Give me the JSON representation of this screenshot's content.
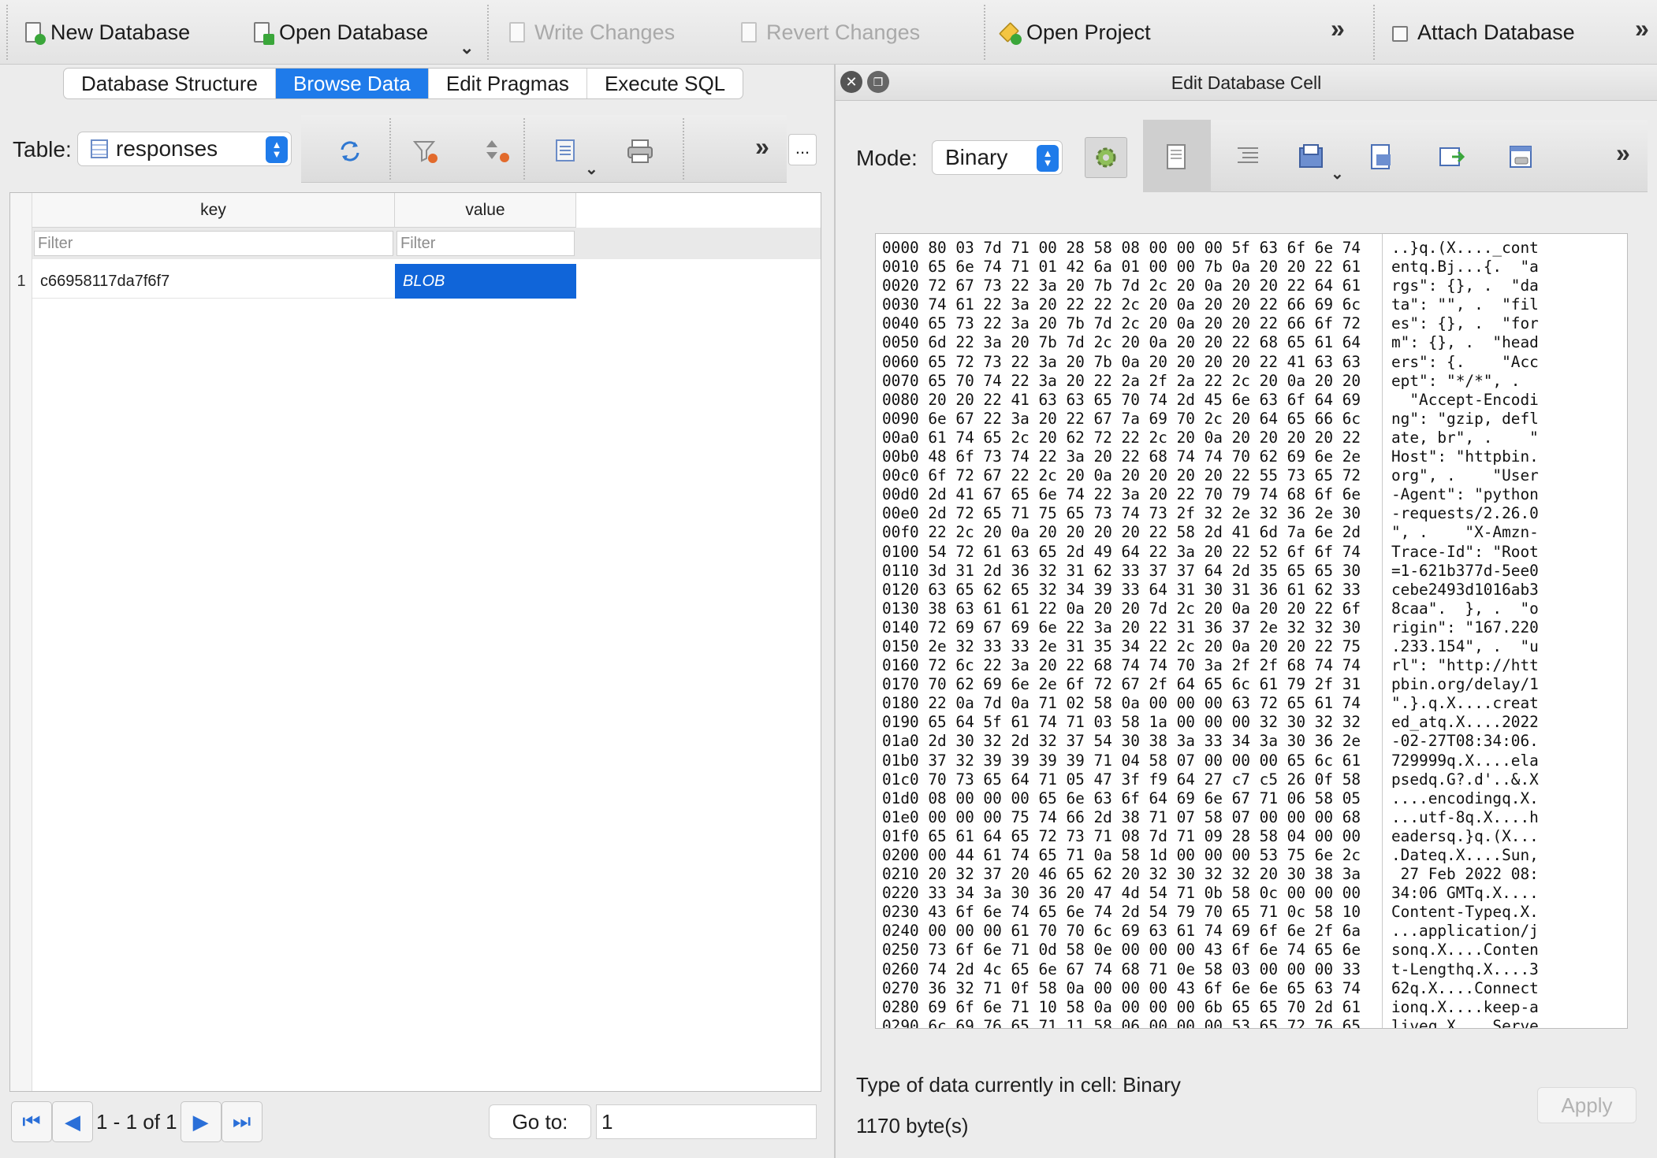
{
  "toolbar": {
    "new_db": "New Database",
    "open_db": "Open Database",
    "write": "Write Changes",
    "revert": "Revert Changes",
    "open_project": "Open Project",
    "attach": "Attach Database",
    "overflow_glyph": "»"
  },
  "tabs": [
    "Database Structure",
    "Browse Data",
    "Edit Pragmas",
    "Execute SQL"
  ],
  "browse": {
    "table_label": "Table:",
    "table_value": "responses",
    "more_glyph": "...",
    "columns": [
      "key",
      "value"
    ],
    "filter_placeholder": "Filter",
    "rows": [
      {
        "num": "1",
        "key": "c66958117da7f6f7",
        "value": "BLOB"
      }
    ],
    "pagination": "1 - 1 of 1",
    "goto_label": "Go to:",
    "goto_value": "1"
  },
  "edit_cell": {
    "title": "Edit Database Cell",
    "mode_label": "Mode:",
    "mode_value": "Binary",
    "hex_lines": [
      "0000 80 03 7d 71 00 28 58 08 00 00 00 5f 63 6f 6e 74",
      "0010 65 6e 74 71 01 42 6a 01 00 00 7b 0a 20 20 22 61",
      "0020 72 67 73 22 3a 20 7b 7d 2c 20 0a 20 20 22 64 61",
      "0030 74 61 22 3a 20 22 22 2c 20 0a 20 20 22 66 69 6c",
      "0040 65 73 22 3a 20 7b 7d 2c 20 0a 20 20 22 66 6f 72",
      "0050 6d 22 3a 20 7b 7d 2c 20 0a 20 20 22 68 65 61 64",
      "0060 65 72 73 22 3a 20 7b 0a 20 20 20 20 22 41 63 63",
      "0070 65 70 74 22 3a 20 22 2a 2f 2a 22 2c 20 0a 20 20",
      "0080 20 20 22 41 63 63 65 70 74 2d 45 6e 63 6f 64 69",
      "0090 6e 67 22 3a 20 22 67 7a 69 70 2c 20 64 65 66 6c",
      "00a0 61 74 65 2c 20 62 72 22 2c 20 0a 20 20 20 20 22",
      "00b0 48 6f 73 74 22 3a 20 22 68 74 74 70 62 69 6e 2e",
      "00c0 6f 72 67 22 2c 20 0a 20 20 20 20 22 55 73 65 72",
      "00d0 2d 41 67 65 6e 74 22 3a 20 22 70 79 74 68 6f 6e",
      "00e0 2d 72 65 71 75 65 73 74 73 2f 32 2e 32 36 2e 30",
      "00f0 22 2c 20 0a 20 20 20 20 22 58 2d 41 6d 7a 6e 2d",
      "0100 54 72 61 63 65 2d 49 64 22 3a 20 22 52 6f 6f 74",
      "0110 3d 31 2d 36 32 31 62 33 37 37 64 2d 35 65 65 30",
      "0120 63 65 62 65 32 34 39 33 64 31 30 31 36 61 62 33",
      "0130 38 63 61 61 22 0a 20 20 7d 2c 20 0a 20 20 22 6f",
      "0140 72 69 67 69 6e 22 3a 20 22 31 36 37 2e 32 32 30",
      "0150 2e 32 33 33 2e 31 35 34 22 2c 20 0a 20 20 22 75",
      "0160 72 6c 22 3a 20 22 68 74 74 70 3a 2f 2f 68 74 74",
      "0170 70 62 69 6e 2e 6f 72 67 2f 64 65 6c 61 79 2f 31",
      "0180 22 0a 7d 0a 71 02 58 0a 00 00 00 63 72 65 61 74",
      "0190 65 64 5f 61 74 71 03 58 1a 00 00 00 32 30 32 32",
      "01a0 2d 30 32 2d 32 37 54 30 38 3a 33 34 3a 30 36 2e",
      "01b0 37 32 39 39 39 39 71 04 58 07 00 00 00 65 6c 61",
      "01c0 70 73 65 64 71 05 47 3f f9 64 27 c7 c5 26 0f 58",
      "01d0 08 00 00 00 65 6e 63 6f 64 69 6e 67 71 06 58 05",
      "01e0 00 00 00 75 74 66 2d 38 71 07 58 07 00 00 00 68",
      "01f0 65 61 64 65 72 73 71 08 7d 71 09 28 58 04 00 00",
      "0200 00 44 61 74 65 71 0a 58 1d 00 00 00 53 75 6e 2c",
      "0210 20 32 37 20 46 65 62 20 32 30 32 32 20 30 38 3a",
      "0220 33 34 3a 30 36 20 47 4d 54 71 0b 58 0c 00 00 00",
      "0230 43 6f 6e 74 65 6e 74 2d 54 79 70 65 71 0c 58 10",
      "0240 00 00 00 61 70 70 6c 69 63 61 74 69 6f 6e 2f 6a",
      "0250 73 6f 6e 71 0d 58 0e 00 00 00 43 6f 6e 74 65 6e",
      "0260 74 2d 4c 65 6e 67 74 68 71 0e 58 03 00 00 00 33",
      "0270 36 32 71 0f 58 0a 00 00 00 43 6f 6e 6e 65 63 74",
      "0280 69 6f 6e 71 10 58 0a 00 00 00 6b 65 65 70 2d 61",
      "0290 6c 69 76 65 71 11 58 06 00 00 00 53 65 72 76 65"
    ],
    "ascii_lines": [
      "..}q.(X...._cont",
      "entq.Bj...{.  \"a",
      "rgs\": {}, .  \"da",
      "ta\": \"\", .  \"fil",
      "es\": {}, .  \"for",
      "m\": {}, .  \"head",
      "ers\": {.    \"Acc",
      "ept\": \"*/*\", .  ",
      "  \"Accept-Encodi",
      "ng\": \"gzip, defl",
      "ate, br\", .    \"",
      "Host\": \"httpbin.",
      "org\", .    \"User",
      "-Agent\": \"python",
      "-requests/2.26.0",
      "\", .    \"X-Amzn-",
      "Trace-Id\": \"Root",
      "=1-621b377d-5ee0",
      "cebe2493d1016ab3",
      "8caa\".  }, .  \"o",
      "rigin\": \"167.220",
      ".233.154\", .  \"u",
      "rl\": \"http://htt",
      "pbin.org/delay/1",
      "\".}.q.X....creat",
      "ed_atq.X....2022",
      "-02-27T08:34:06.",
      "729999q.X....ela",
      "psedq.G?.d'..&.X",
      "....encodingq.X.",
      "...utf-8q.X....h",
      "eadersq.}q.(X...",
      ".Dateq.X....Sun,",
      " 27 Feb 2022 08:",
      "34:06 GMTq.X....",
      "Content-Typeq.X.",
      "...application/j",
      "sonq.X....Conten",
      "t-Lengthq.X....3",
      "62q.X....Connect",
      "ionq.X....keep-a",
      "liveq.X....Serve"
    ],
    "type_info": "Type of data currently in cell: Binary",
    "size_info": "1170 byte(s)",
    "apply": "Apply"
  }
}
